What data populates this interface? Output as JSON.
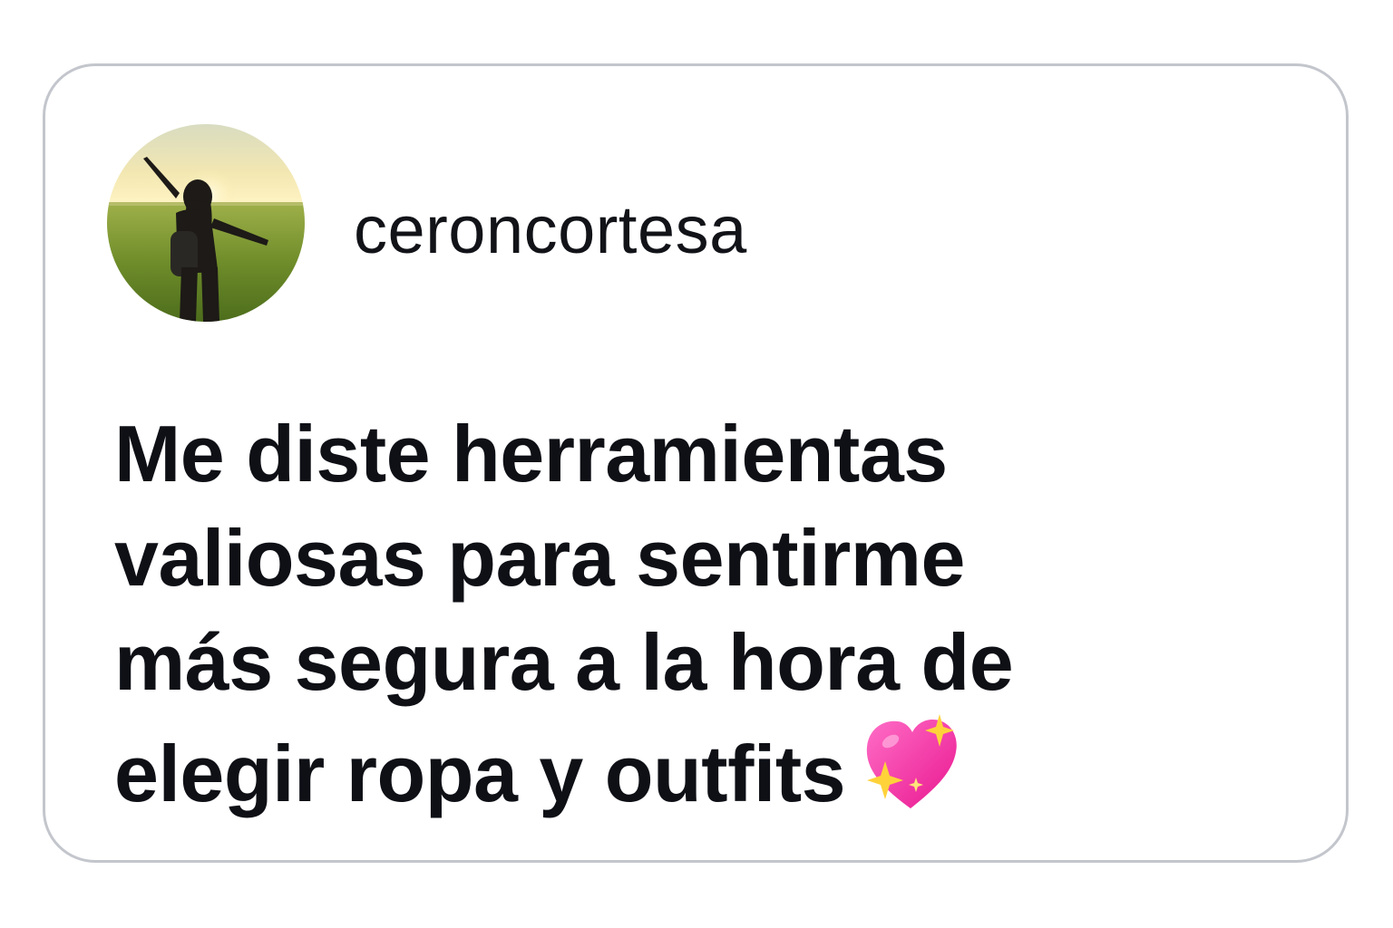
{
  "post": {
    "username": "ceroncortesa",
    "avatar_icon": "profile-photo-person-in-field",
    "message_lines": [
      "Me diste herramientas",
      "valiosas para sentirme",
      "más segura a la hora de",
      "elegir ropa y outfits"
    ],
    "emoji_icon": "sparkling-heart-icon"
  },
  "colors": {
    "border": "#c3c6cc",
    "text": "#0e1016",
    "heart": "#ff3fa6",
    "sparkle": "#ffd23a"
  }
}
